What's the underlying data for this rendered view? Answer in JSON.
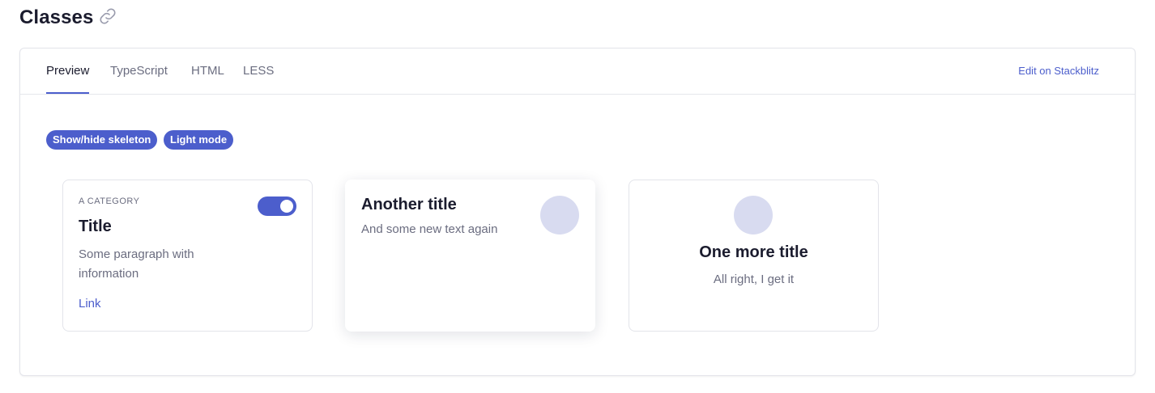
{
  "page": {
    "title": "Classes",
    "title_icon": "link-icon"
  },
  "tabs": [
    {
      "label": "Preview",
      "active": true
    },
    {
      "label": "TypeScript",
      "active": false
    },
    {
      "label": "HTML",
      "active": false
    },
    {
      "label": "LESS",
      "active": false
    }
  ],
  "edit_link": "Edit on Stackblitz",
  "controls": {
    "skeleton_button": "Show/hide skeleton",
    "theme_button": "Light mode"
  },
  "cards": [
    {
      "category": "A CATEGORY",
      "title": "Title",
      "paragraph": "Some paragraph with information",
      "link": "Link",
      "toggle_on": true
    },
    {
      "title": "Another title",
      "paragraph": "And some new text again"
    },
    {
      "title": "One more title",
      "paragraph": "All right, I get it"
    }
  ],
  "colors": {
    "accent": "#4c5ecc",
    "avatar": "#d8dbf0",
    "text": "#1b1c2e",
    "muted": "#6b6d80",
    "border": "#e3e4ea"
  }
}
